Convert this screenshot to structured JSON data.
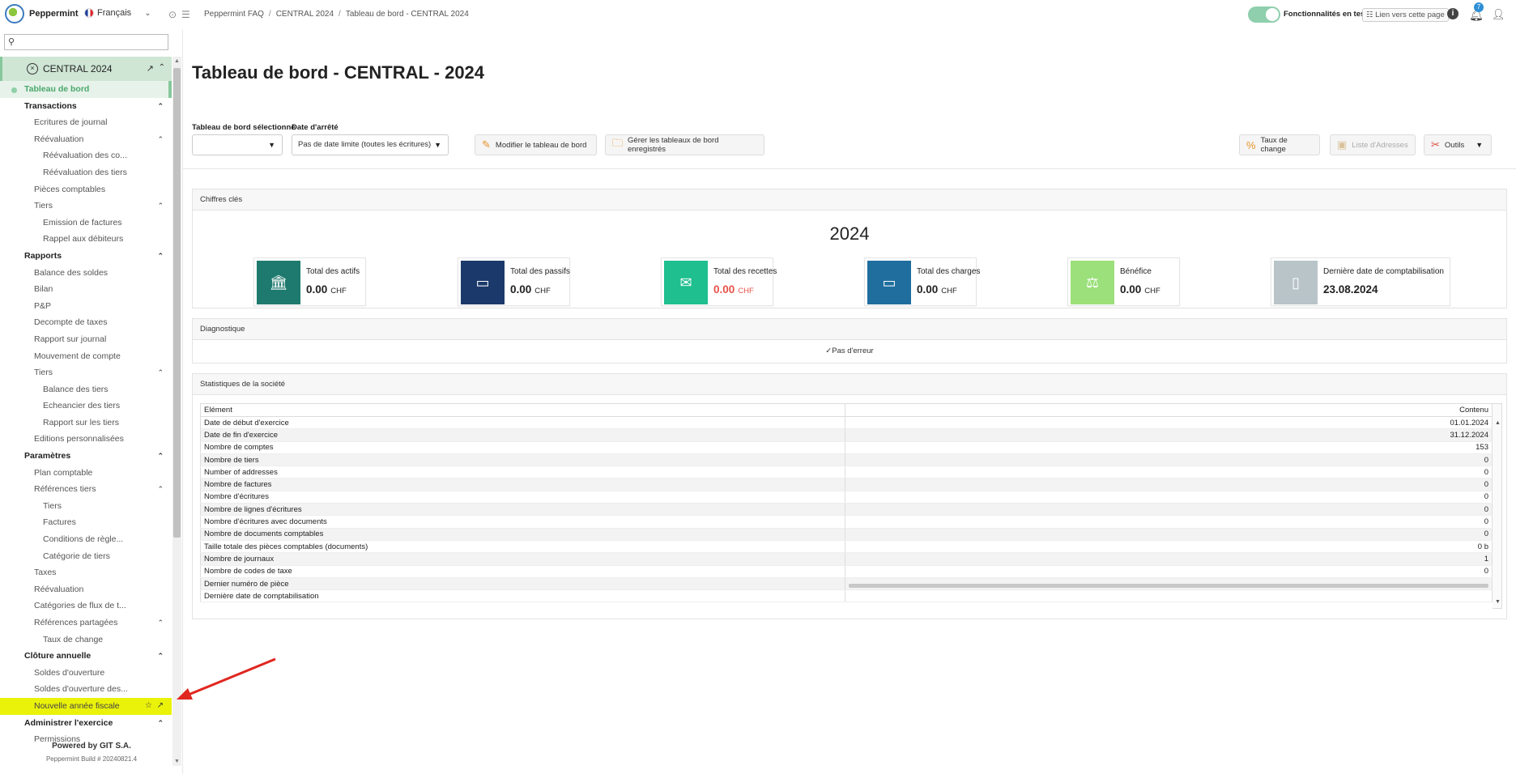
{
  "app": {
    "name": "Peppermint"
  },
  "language": {
    "label": "Français"
  },
  "breadcrumb": [
    "Peppermint FAQ",
    "CENTRAL 2024",
    "Tableau de bord - CENTRAL 2024"
  ],
  "topbar": {
    "test_features_label": "Fonctionnalités en test",
    "page_link_label": "Lien vers cette page",
    "notification_count": "7"
  },
  "sidebar": {
    "search_placeholder": "",
    "company": "CENTRAL 2024",
    "items": [
      {
        "label": "Tableau de bord",
        "level": "dash"
      },
      {
        "label": "Transactions",
        "level": "l0",
        "caret": "up"
      },
      {
        "label": "Ecritures de journal",
        "level": "l1"
      },
      {
        "label": "Réévaluation",
        "level": "l1",
        "caret": "up"
      },
      {
        "label": "Réévaluation des co...",
        "level": "l2"
      },
      {
        "label": "Réévaluation des tiers",
        "level": "l2"
      },
      {
        "label": "Pièces comptables",
        "level": "l1"
      },
      {
        "label": "Tiers",
        "level": "l1",
        "caret": "up"
      },
      {
        "label": "Emission de factures",
        "level": "l2"
      },
      {
        "label": "Rappel aux débiteurs",
        "level": "l2"
      },
      {
        "label": "Rapports",
        "level": "l0",
        "caret": "up"
      },
      {
        "label": "Balance des soldes",
        "level": "l1"
      },
      {
        "label": "Bilan",
        "level": "l1"
      },
      {
        "label": "P&P",
        "level": "l1"
      },
      {
        "label": "Decompte de taxes",
        "level": "l1"
      },
      {
        "label": "Rapport sur journal",
        "level": "l1"
      },
      {
        "label": "Mouvement de compte",
        "level": "l1"
      },
      {
        "label": "Tiers",
        "level": "l1",
        "caret": "up"
      },
      {
        "label": "Balance des tiers",
        "level": "l2"
      },
      {
        "label": "Echeancier des tiers",
        "level": "l2"
      },
      {
        "label": "Rapport sur les tiers",
        "level": "l2"
      },
      {
        "label": "Editions personnalisées",
        "level": "l1"
      },
      {
        "label": "Paramètres",
        "level": "l0",
        "caret": "up"
      },
      {
        "label": "Plan comptable",
        "level": "l1"
      },
      {
        "label": "Références tiers",
        "level": "l1",
        "caret": "up"
      },
      {
        "label": "Tiers",
        "level": "l2"
      },
      {
        "label": "Factures",
        "level": "l2"
      },
      {
        "label": "Conditions de règle...",
        "level": "l2"
      },
      {
        "label": "Catégorie de tiers",
        "level": "l2"
      },
      {
        "label": "Taxes",
        "level": "l1"
      },
      {
        "label": "Réévaluation",
        "level": "l1"
      },
      {
        "label": "Catégories de flux de t...",
        "level": "l1"
      },
      {
        "label": "Références partagées",
        "level": "l1",
        "caret": "up"
      },
      {
        "label": "Taux de change",
        "level": "l2"
      },
      {
        "label": "Clôture annuelle",
        "level": "l0",
        "caret": "up"
      },
      {
        "label": "Soldes d'ouverture",
        "level": "l1"
      },
      {
        "label": "Soldes d'ouverture des...",
        "level": "l1"
      },
      {
        "label": "Nouvelle année fiscale",
        "level": "l1",
        "highlight": true
      },
      {
        "label": "Administrer l'exercice",
        "level": "l0",
        "caret": "up"
      },
      {
        "label": "Permissions",
        "level": "l1"
      }
    ],
    "powered_by": "Powered by GIT S.A.",
    "build": "Peppermint Build # 20240821.4"
  },
  "main": {
    "title": "Tableau de bord - CENTRAL - 2024",
    "selected_dashboard_label": "Tableau de bord sélectionné",
    "selected_dashboard_value": "",
    "cutoff_label": "Date d'arrêté",
    "cutoff_value": "Pas de date limite (toutes les écritures)",
    "buttons": {
      "edit_dashboard": "Modifier le tableau de bord",
      "manage_dashboards": "Gérer les tableaux de bord enregistrés",
      "exchange_rates": "Taux de change",
      "address_list": "Liste d'Adresses",
      "tools": "Outils"
    },
    "key_figures": {
      "title": "Chiffres clés",
      "year": "2024",
      "cards": [
        {
          "label": "Total des actifs",
          "value": "0.00",
          "currency": "CHF",
          "color": "#1e7a6e",
          "icon": "bank-icon",
          "negative": false
        },
        {
          "label": "Total des passifs",
          "value": "0.00",
          "currency": "CHF",
          "color": "#1b3a6b",
          "icon": "bill-icon",
          "negative": false
        },
        {
          "label": "Total des recettes",
          "value": "0.00",
          "currency": "CHF",
          "color": "#1fbf8f",
          "icon": "bill-hand-icon",
          "negative": true
        },
        {
          "label": "Total des charges",
          "value": "0.00",
          "currency": "CHF",
          "color": "#1f6e9e",
          "icon": "bill-icon",
          "negative": false
        },
        {
          "label": "Bénéfice",
          "value": "0.00",
          "currency": "CHF",
          "color": "#9be07a",
          "icon": "scale-icon",
          "negative": false
        },
        {
          "label": "Dernière date de comptabilisation",
          "value": "23.08.2024",
          "currency": "",
          "color": "#b8c4c8",
          "icon": "book-icon",
          "negative": false
        }
      ]
    },
    "diagnostics": {
      "title": "Diagnostique",
      "status": "Pas d'erreur"
    },
    "stats": {
      "title": "Statistiques de la société",
      "headers": [
        "Elément",
        "Contenu"
      ],
      "rows": [
        [
          "Date de début d'exercice",
          "01.01.2024"
        ],
        [
          "Date de fin d'exercice",
          "31.12.2024"
        ],
        [
          "Nombre de comptes",
          "153"
        ],
        [
          "Nombre de tiers",
          "0"
        ],
        [
          "Number of addresses",
          "0"
        ],
        [
          "Nombre de factures",
          "0"
        ],
        [
          "Nombre d'écritures",
          "0"
        ],
        [
          "Nombre de lignes d'écritures",
          "0"
        ],
        [
          "Nombre d'écritures avec documents",
          "0"
        ],
        [
          "Nombre de documents comptables",
          "0"
        ],
        [
          "Taille totale des pièces comptables (documents)",
          "0 b"
        ],
        [
          "Nombre de journaux",
          "1"
        ],
        [
          "Nombre de codes de taxe",
          "0"
        ],
        [
          "Dernier numéro de pièce",
          ""
        ],
        [
          "Dernière date de comptabilisation",
          ""
        ]
      ]
    }
  }
}
